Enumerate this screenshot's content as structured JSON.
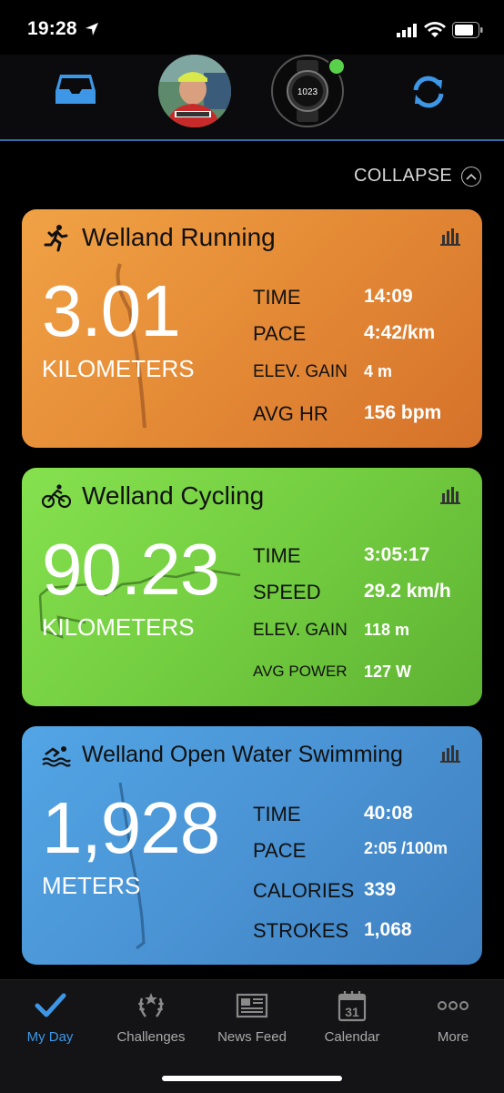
{
  "status": {
    "time": "19:28"
  },
  "top_nav": {
    "watch_screen_text": "1023"
  },
  "collapse": {
    "label": "COLLAPSE"
  },
  "cards": [
    {
      "title": "Welland Running",
      "icon": "running-icon",
      "value": "3.01",
      "unit": "KILOMETERS",
      "color": "#e48a36",
      "stats": [
        {
          "label": "TIME",
          "value": "14:09"
        },
        {
          "label": "PACE",
          "value": "4:42/km"
        },
        {
          "label": "ELEV. GAIN",
          "value": "4 m"
        },
        {
          "label": "AVG HR",
          "value": "156 bpm"
        }
      ]
    },
    {
      "title": "Welland Cycling",
      "icon": "cycling-icon",
      "value": "90.23",
      "unit": "KILOMETERS",
      "color": "#73cd40",
      "stats": [
        {
          "label": "TIME",
          "value": "3:05:17"
        },
        {
          "label": "SPEED",
          "value": "29.2 km/h"
        },
        {
          "label": "ELEV. GAIN",
          "value": "118 m"
        },
        {
          "label": "AVG POWER",
          "value": "127 W"
        }
      ]
    },
    {
      "title": "Welland Open Water Swimming",
      "icon": "swimming-icon",
      "value": "1,928",
      "unit": "METERS",
      "color": "#4a93d4",
      "stats": [
        {
          "label": "TIME",
          "value": "40:08"
        },
        {
          "label": "PACE",
          "value": "2:05 /100m"
        },
        {
          "label": "CALORIES",
          "value": "339"
        },
        {
          "label": "STROKES",
          "value": "1,068"
        }
      ]
    }
  ],
  "tabs": [
    {
      "label": "My Day",
      "icon": "checkmark-icon",
      "active": true
    },
    {
      "label": "Challenges",
      "icon": "laurel-icon",
      "active": false
    },
    {
      "label": "News Feed",
      "icon": "newspaper-icon",
      "active": false
    },
    {
      "label": "Calendar",
      "icon": "calendar-icon",
      "active": false,
      "badge": "31"
    },
    {
      "label": "More",
      "icon": "more-icon",
      "active": false
    }
  ],
  "colors": {
    "accent": "#3d97e6",
    "connected": "#59d14a"
  }
}
